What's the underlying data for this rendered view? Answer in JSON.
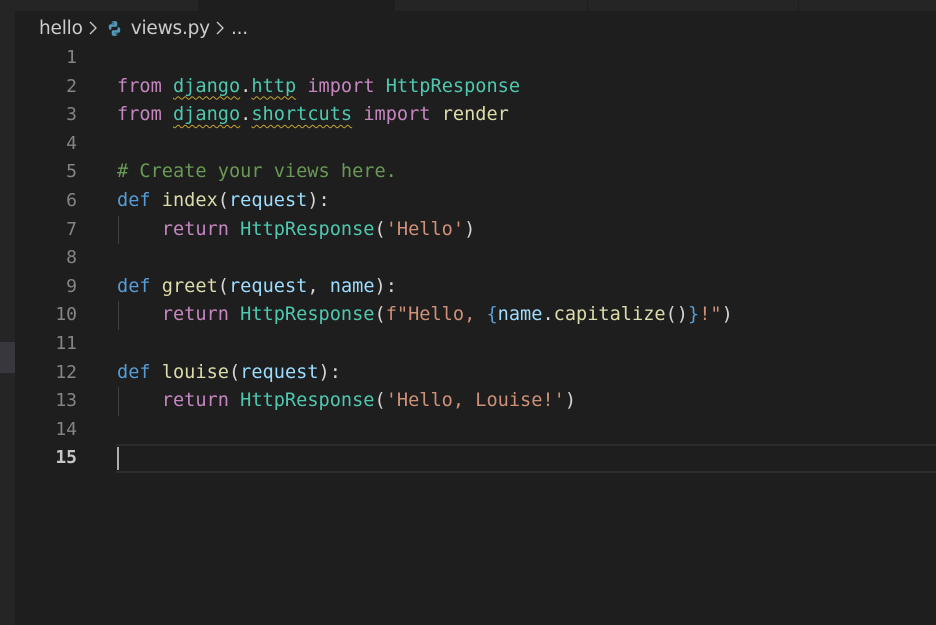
{
  "breadcrumb": {
    "folder": "hello",
    "file": "views.py",
    "more": "..."
  },
  "editor": {
    "current_line": 15,
    "lines": [
      {
        "num": "1"
      },
      {
        "num": "2",
        "t": [
          "from",
          " ",
          "django",
          ".",
          "http",
          " ",
          "import",
          " ",
          "HttpResponse"
        ]
      },
      {
        "num": "3",
        "t": [
          "from",
          " ",
          "django",
          ".",
          "shortcuts",
          " ",
          "import",
          " ",
          "render"
        ]
      },
      {
        "num": "4"
      },
      {
        "num": "5",
        "t": [
          "# Create your views here."
        ]
      },
      {
        "num": "6",
        "t": [
          "def",
          " ",
          "index",
          "(",
          "request",
          "):"
        ]
      },
      {
        "num": "7",
        "t": [
          "    ",
          "return",
          " ",
          "HttpResponse",
          "(",
          "'Hello'",
          ")"
        ]
      },
      {
        "num": "8"
      },
      {
        "num": "9",
        "t": [
          "def",
          " ",
          "greet",
          "(",
          "request",
          ", ",
          "name",
          "):"
        ]
      },
      {
        "num": "10",
        "t": [
          "    ",
          "return",
          " ",
          "HttpResponse",
          "(",
          "f\"Hello, ",
          "{",
          "name",
          ".",
          "capitalize",
          "()",
          "}",
          "!\"",
          ")"
        ]
      },
      {
        "num": "11"
      },
      {
        "num": "12",
        "t": [
          "def",
          " ",
          "louise",
          "(",
          "request",
          "):"
        ]
      },
      {
        "num": "13",
        "t": [
          "    ",
          "return",
          " ",
          "HttpResponse",
          "(",
          "'Hello, Louise!'",
          ")"
        ]
      },
      {
        "num": "14"
      },
      {
        "num": "15"
      }
    ]
  },
  "colors": {
    "background": "#1e1e1e",
    "keyword_control": "#c586c0",
    "keyword_def": "#569cd6",
    "function": "#dcdcaa",
    "class_module": "#4ec9b0",
    "variable": "#9cdcfe",
    "string": "#ce9178",
    "comment": "#6a9955"
  }
}
